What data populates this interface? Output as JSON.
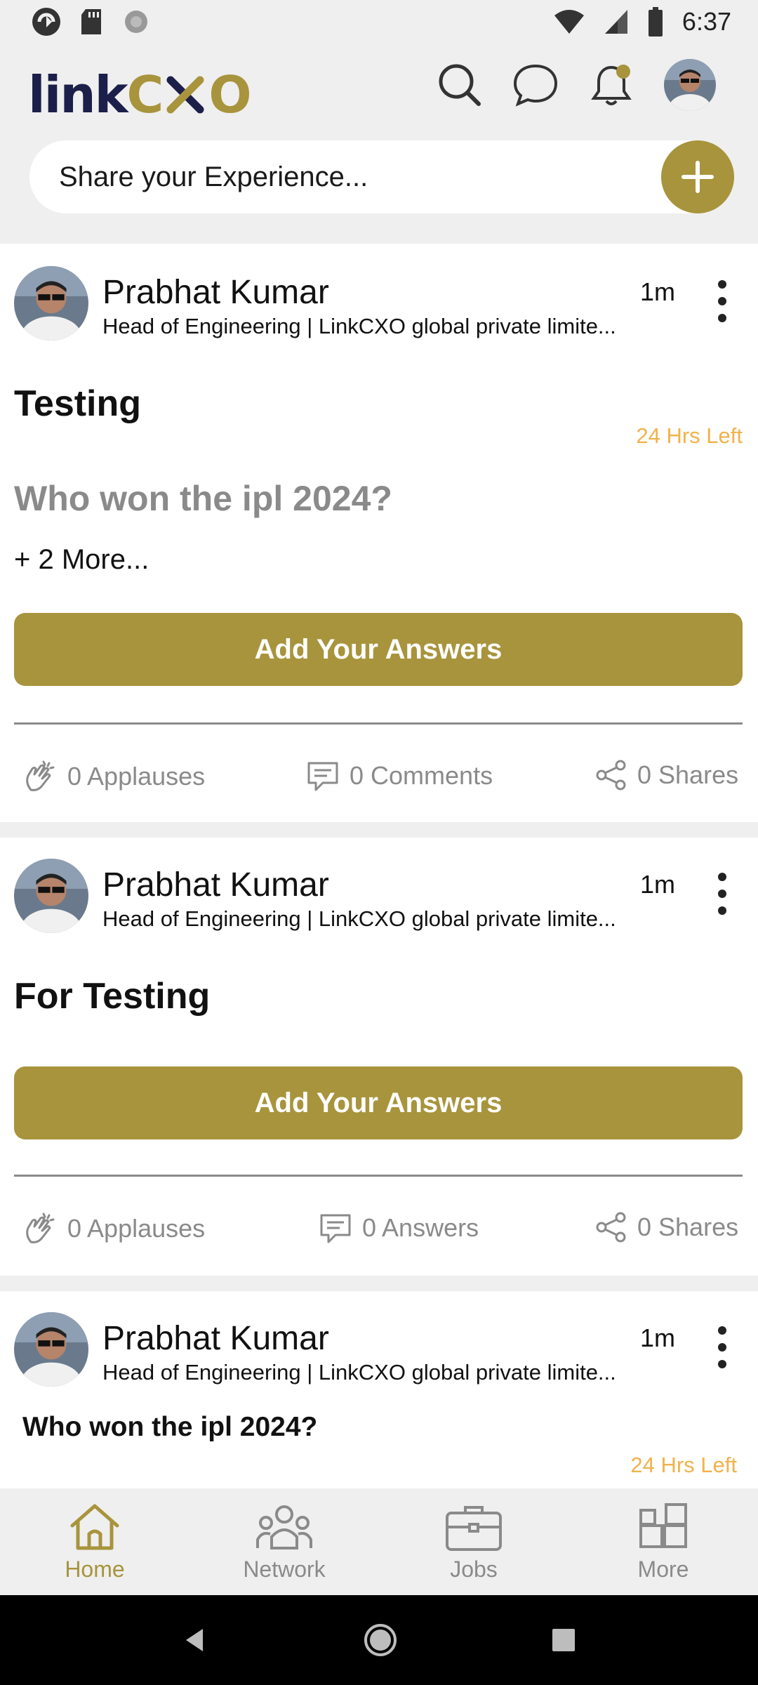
{
  "status_bar": {
    "time": "6:37"
  },
  "header": {
    "logo_link": "link",
    "logo_c": "C",
    "logo_o": "O",
    "share_placeholder": "Share your Experience..."
  },
  "posts": [
    {
      "author": "Prabhat Kumar",
      "title": "Head of Engineering | LinkCXO global private limite...",
      "time": "1m",
      "post_title": "Testing",
      "hrs_left": "24 Hrs Left",
      "question": "Who won the ipl 2024?",
      "more": "+ 2 More...",
      "button": "Add Your Answers",
      "applauses": "0 Applauses",
      "comments": "0 Comments",
      "shares": "0 Shares"
    },
    {
      "author": "Prabhat Kumar",
      "title": "Head of Engineering | LinkCXO global private limite...",
      "time": "1m",
      "post_title": "For Testing",
      "button": "Add Your Answers",
      "applauses": "0 Applauses",
      "answers": "0 Answers",
      "shares": "0 Shares"
    },
    {
      "author": "Prabhat Kumar",
      "title": "Head of Engineering | LinkCXO global private limite...",
      "time": "1m",
      "question": "Who won the ipl 2024?",
      "hrs_left": "24 Hrs Left"
    }
  ],
  "bottom_nav": {
    "home": "Home",
    "network": "Network",
    "jobs": "Jobs",
    "more": "More"
  },
  "colors": {
    "brand_gold": "#a8943c",
    "brand_navy": "#1b1f4a",
    "timer_orange": "#f2b24a",
    "muted_gray": "#8a8a8a"
  }
}
